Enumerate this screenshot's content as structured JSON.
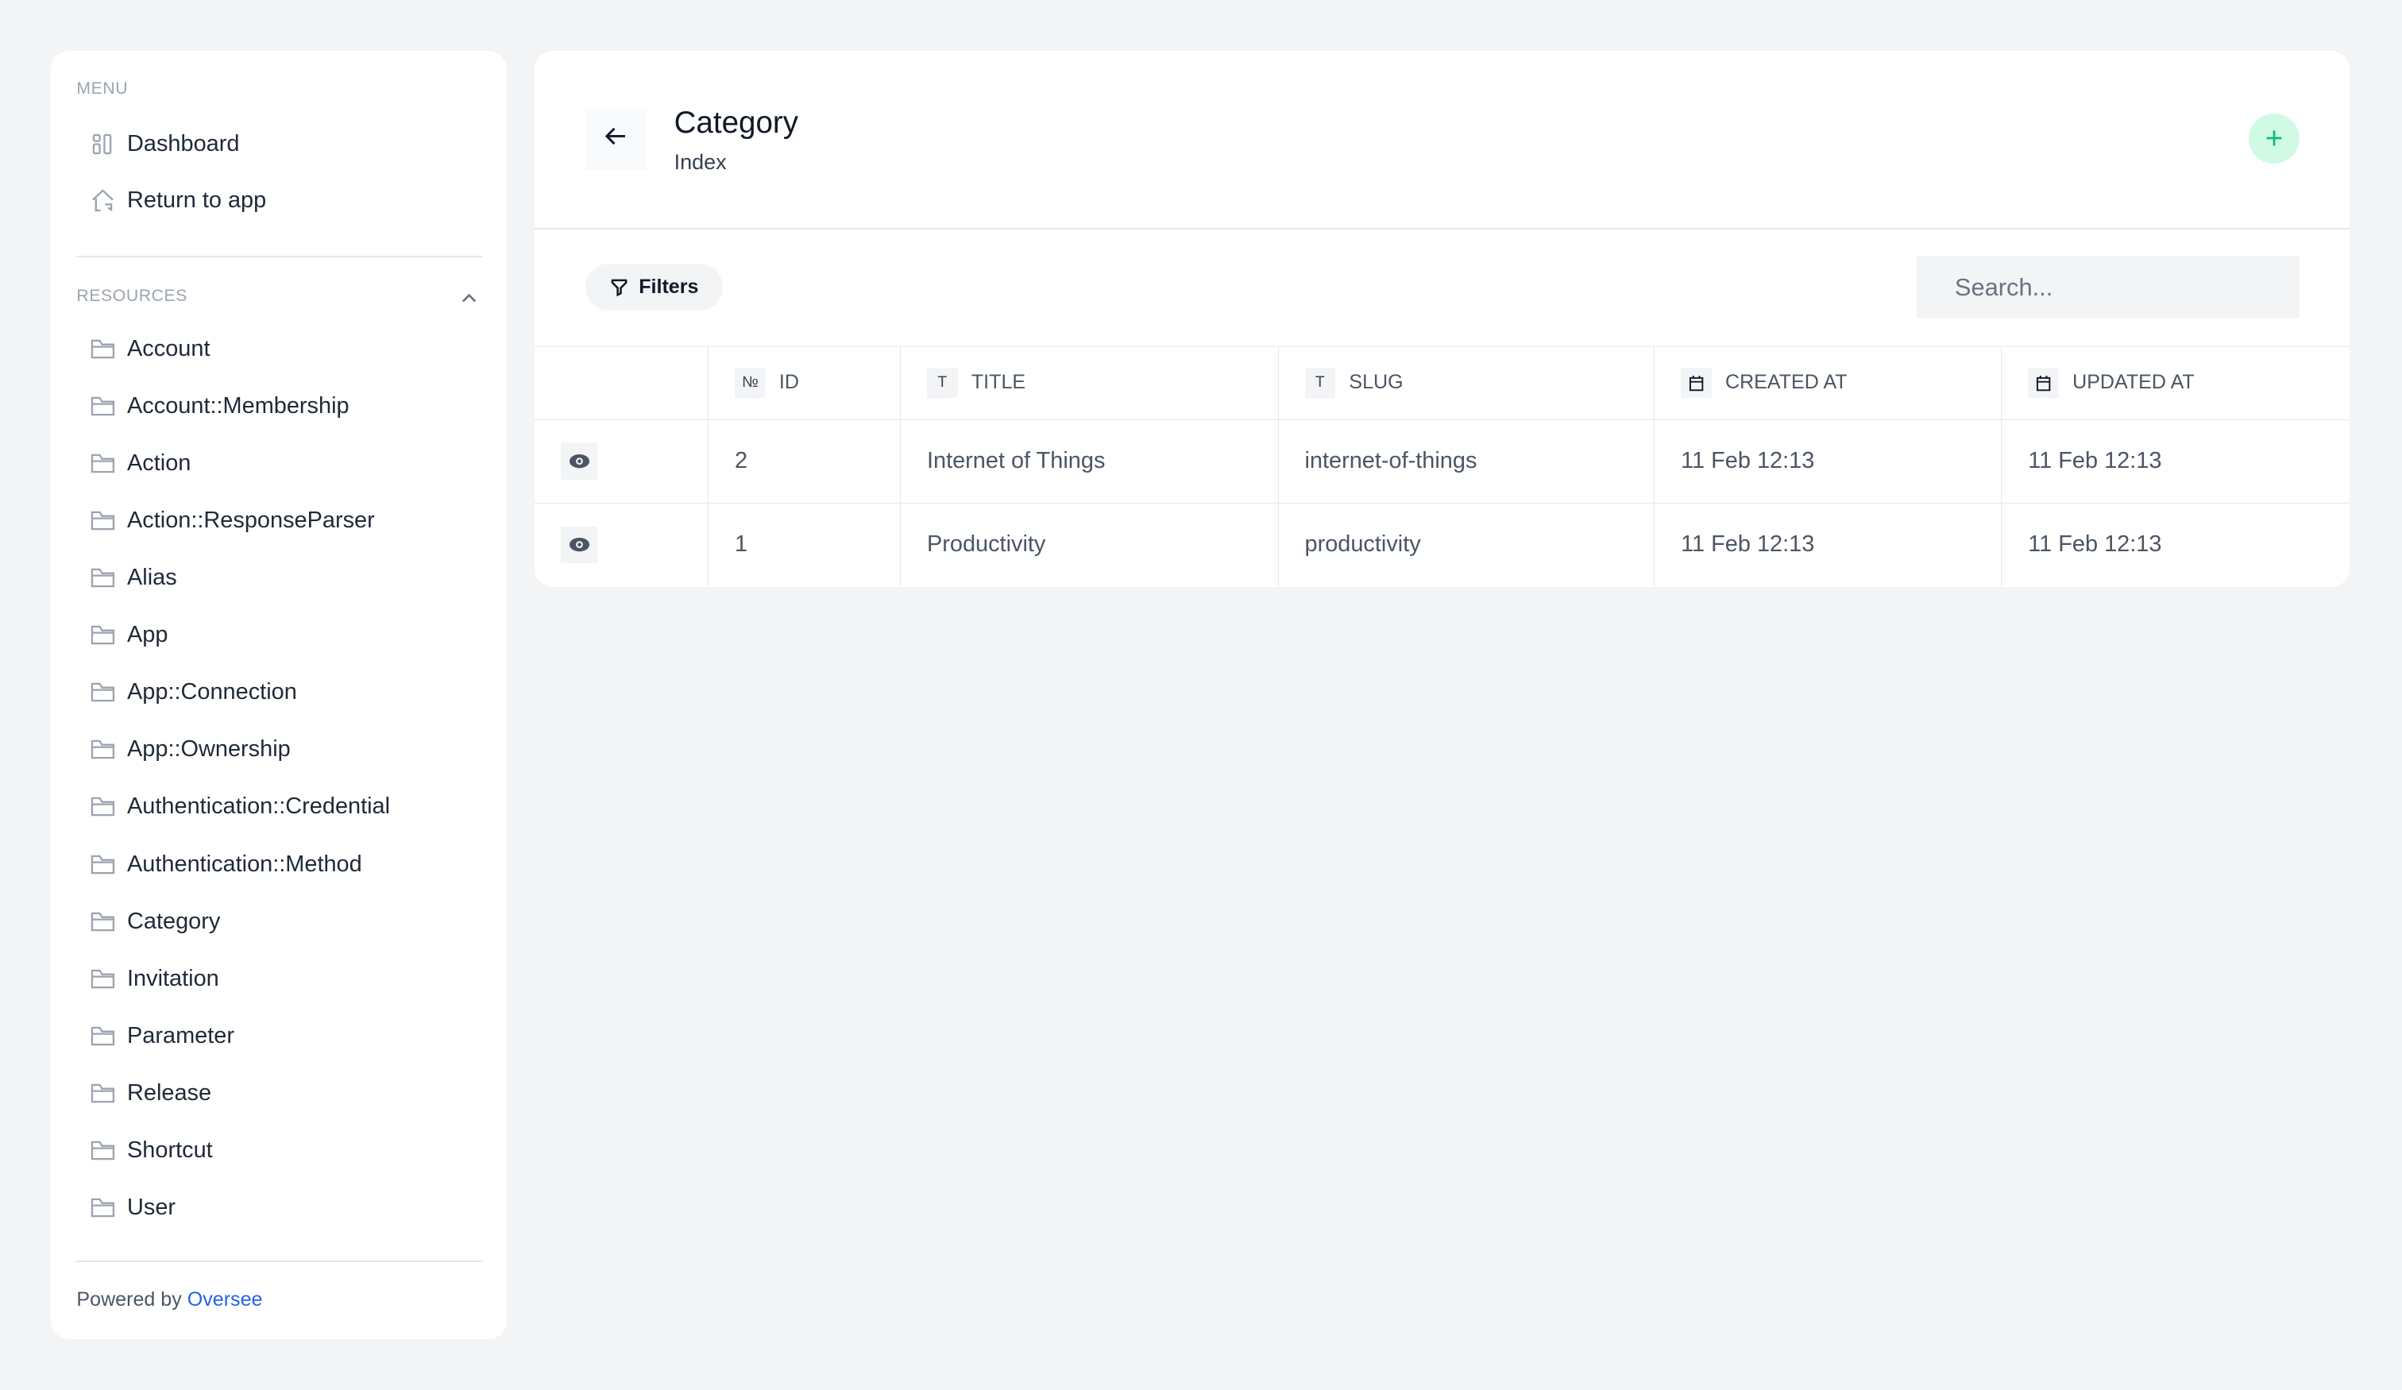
{
  "sidebar": {
    "menu_label": "MENU",
    "menu_items": [
      {
        "label": "Dashboard",
        "icon": "dashboard-icon"
      },
      {
        "label": "Return to app",
        "icon": "home-return-icon"
      }
    ],
    "resources_label": "RESOURCES",
    "resources": [
      "Account",
      "Account::Membership",
      "Action",
      "Action::ResponseParser",
      "Alias",
      "App",
      "App::Connection",
      "App::Ownership",
      "Authentication::Credential",
      "Authentication::Method",
      "Category",
      "Invitation",
      "Parameter",
      "Release",
      "Shortcut",
      "User"
    ],
    "footer_prefix": "Powered by",
    "footer_link": "Oversee"
  },
  "header": {
    "title": "Category",
    "subtitle": "Index"
  },
  "toolbar": {
    "filters_label": "Filters",
    "search_placeholder": "Search..."
  },
  "table": {
    "columns": [
      {
        "label": "ID",
        "icon": "№"
      },
      {
        "label": "TITLE",
        "icon": "T"
      },
      {
        "label": "SLUG",
        "icon": "T"
      },
      {
        "label": "CREATED AT",
        "icon": "calendar"
      },
      {
        "label": "UPDATED AT",
        "icon": "calendar"
      }
    ],
    "rows": [
      [
        "2",
        "Internet of Things",
        "internet-of-things",
        "11 Feb 12:13",
        "11 Feb 12:13"
      ],
      [
        "1",
        "Productivity",
        "productivity",
        "11 Feb 12:13",
        "11 Feb 12:13"
      ]
    ]
  },
  "colors": {
    "accent": "#10b981",
    "accent_bg": "#d1fae5",
    "link": "#2563eb",
    "background": "#f3f4f6"
  }
}
